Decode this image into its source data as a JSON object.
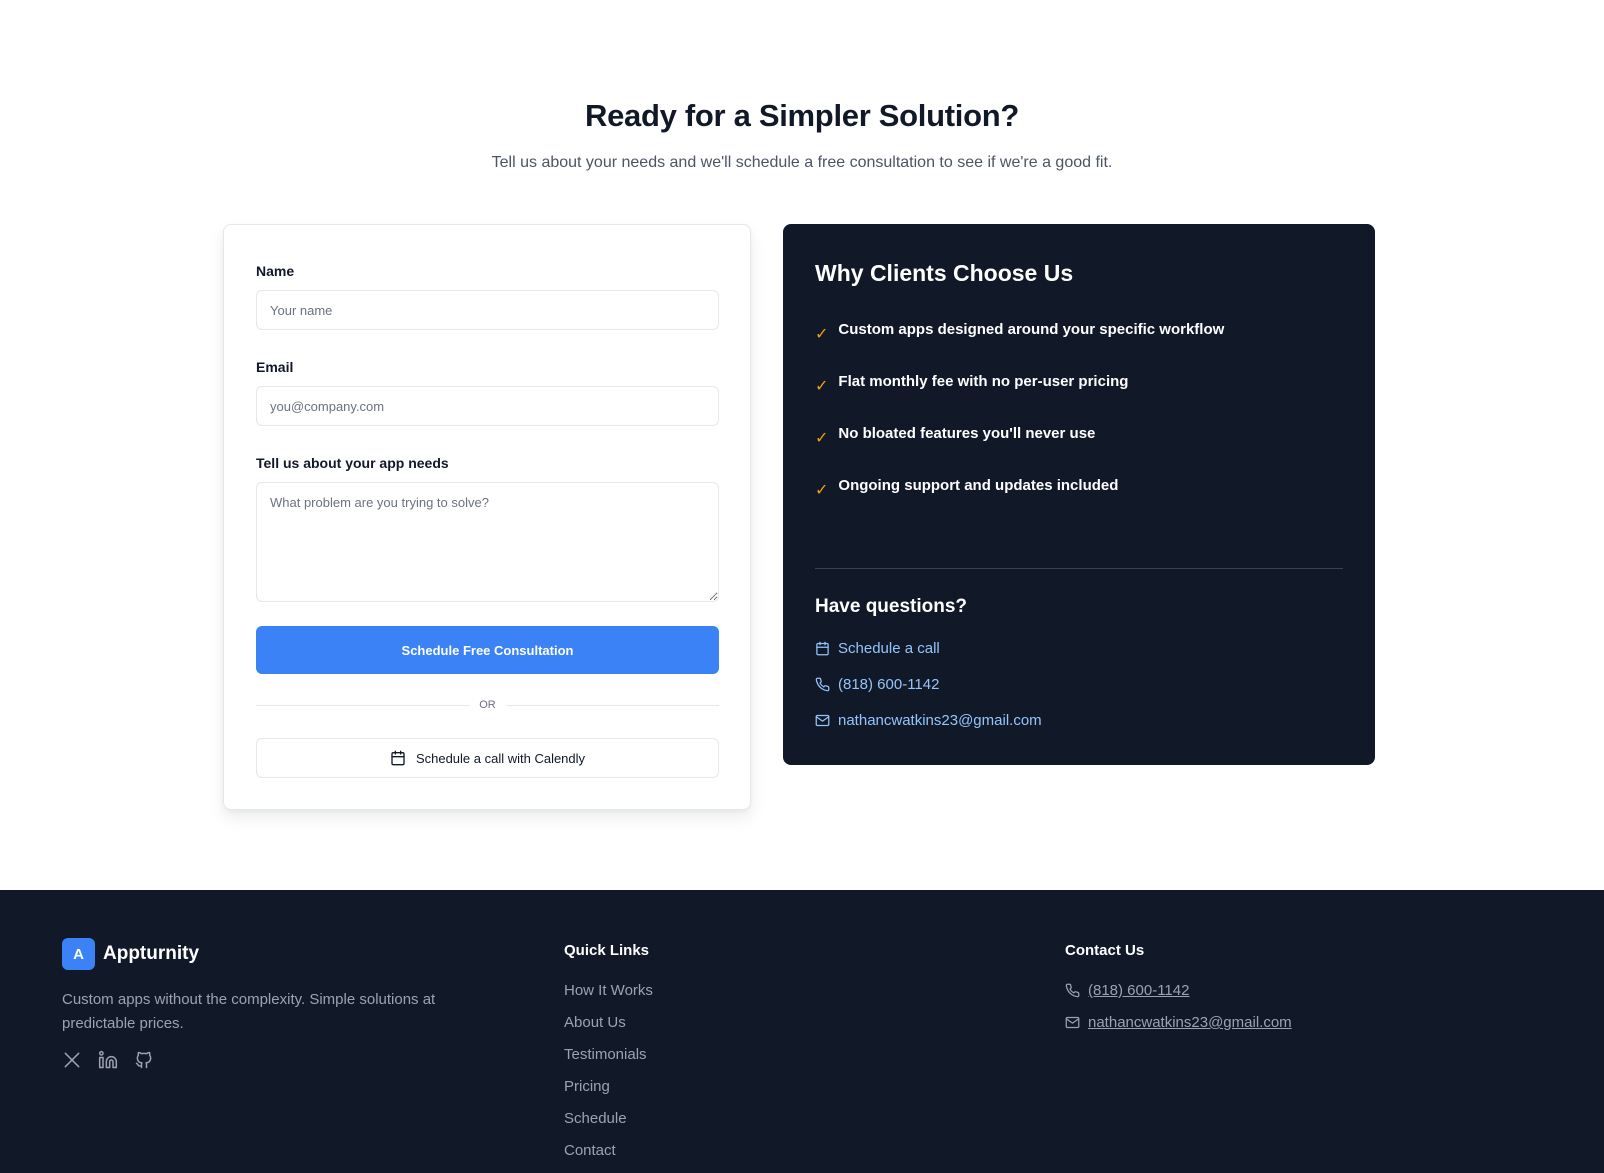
{
  "hero": {
    "title": "Ready for a Simpler Solution?",
    "subtitle": "Tell us about your needs and we'll schedule a free consultation to see if we're a good fit."
  },
  "form": {
    "name_label": "Name",
    "name_placeholder": "Your name",
    "email_label": "Email",
    "email_placeholder": "you@company.com",
    "needs_label": "Tell us about your app needs",
    "needs_placeholder": "What problem are you trying to solve?",
    "submit_label": "Schedule Free Consultation",
    "divider_text": "OR",
    "calendly_label": "Schedule a call with Calendly",
    "calendly_icon": "calendar-icon"
  },
  "why": {
    "title": "Why Clients Choose Us",
    "check_icon": "check-icon",
    "check_color": "#f59e0b",
    "benefits": [
      "Custom apps designed around your specific workflow",
      "Flat monthly fee with no per-user pricing",
      "No bloated features you'll never use",
      "Ongoing support and updates included"
    ],
    "questions_title": "Have questions?",
    "links": [
      {
        "icon": "calendar-icon",
        "text": "Schedule a call"
      },
      {
        "icon": "phone-icon",
        "text": "(818) 600-1142"
      },
      {
        "icon": "mail-icon",
        "text": "nathancwatkins23@gmail.com"
      }
    ]
  },
  "footer": {
    "brand_initial": "A",
    "brand_name": "Appturnity",
    "tagline": "Custom apps without the complexity. Simple solutions at predictable prices.",
    "socials": [
      "x-icon",
      "linkedin-icon",
      "github-icon"
    ],
    "quick_links_title": "Quick Links",
    "quick_links": [
      "How It Works",
      "About Us",
      "Testimonials",
      "Pricing",
      "Schedule",
      "Contact"
    ],
    "contact_title": "Contact Us",
    "contact": [
      {
        "icon": "phone-icon",
        "text": "(818) 600-1142"
      },
      {
        "icon": "mail-icon",
        "text": "nathancwatkins23@gmail.com"
      }
    ]
  },
  "colors": {
    "accent": "#3b82f6",
    "dark_bg": "#111827",
    "link_light": "#93c5fd",
    "check": "#f59e0b"
  }
}
